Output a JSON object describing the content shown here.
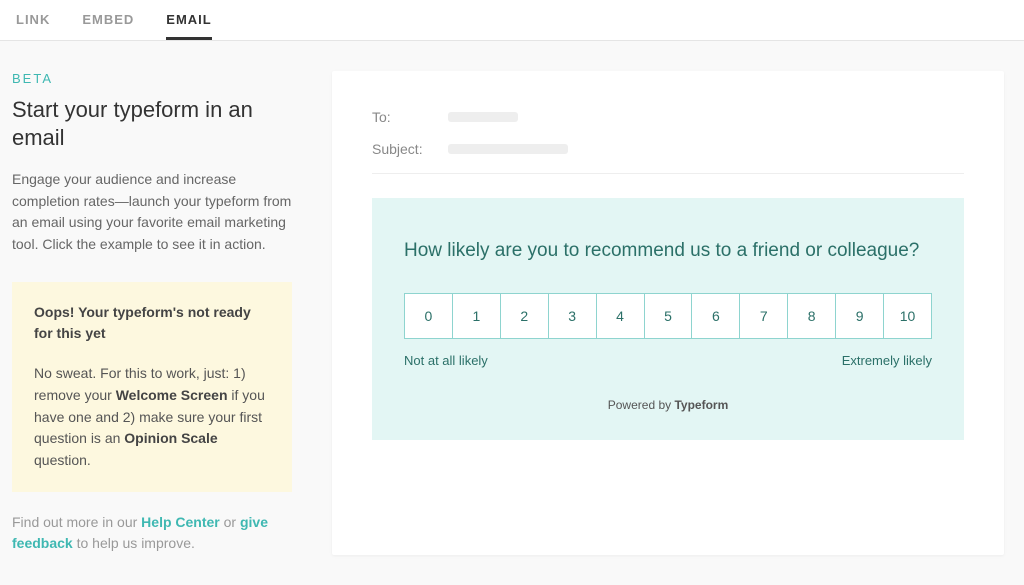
{
  "tabs": {
    "link": "LINK",
    "embed": "EMBED",
    "email": "EMAIL"
  },
  "sidebar": {
    "beta": "BETA",
    "heading": "Start your typeform in an email",
    "desc": "Engage your audience and increase completion rates—launch your typeform from an email using your favorite email marketing tool. Click the example to see it in action.",
    "warning_title": "Oops! Your typeform's not ready for this yet",
    "warning_pre": "No sweat. For this to work, just: 1) remove your ",
    "warning_bold1": "Welcome Screen",
    "warning_mid": " if you have one and 2) make sure your first question is an ",
    "warning_bold2": "Opinion Scale",
    "warning_post": " question.",
    "footer_pre": "Find out more in our ",
    "footer_link1": "Help Center",
    "footer_mid": " or ",
    "footer_link2": "give feedback",
    "footer_post": " to help us improve."
  },
  "preview": {
    "to_label": "To:",
    "subject_label": "Subject:",
    "question": "How likely are you to recommend us to a friend or colleague?",
    "scale": [
      "0",
      "1",
      "2",
      "3",
      "4",
      "5",
      "6",
      "7",
      "8",
      "9",
      "10"
    ],
    "low_label": "Not at all likely",
    "high_label": "Extremely likely",
    "powered_pre": "Powered by ",
    "powered_brand": "Typeform"
  }
}
